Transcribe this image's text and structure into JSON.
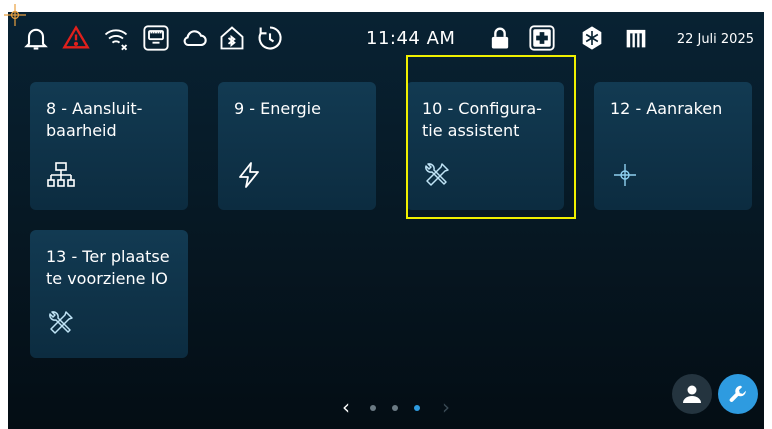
{
  "status_bar": {
    "time": "11:44 AM",
    "date": "22 Juli 2025",
    "icons": [
      "bell-icon",
      "warning-icon",
      "wifi-off-icon",
      "ethernet-icon",
      "cloud-icon",
      "home-bluetooth-icon",
      "timer-icon",
      "lock-icon",
      "medical-cross-icon",
      "snowflake-icon",
      "door-icon"
    ],
    "alert_color": "#e0201c"
  },
  "tiles": [
    {
      "label": "8 - Aansluit-baarheid",
      "icon": "network-icon"
    },
    {
      "label": "9 - Energie",
      "icon": "lightning-icon"
    },
    {
      "label": "10 - Configura-tie assistent",
      "icon": "tools-icon"
    },
    {
      "label": "12 - Aanraken",
      "icon": "crosshair-icon"
    },
    {
      "label": "13 - Ter plaatse te voorziene IO",
      "icon": "tools-icon"
    }
  ],
  "pager": {
    "prev": "‹",
    "next": "›",
    "pages": 3,
    "active_page": 3
  },
  "colors": {
    "tile_bg": "#0f3349",
    "accent": "#2e9be0",
    "highlight": "#f0f000"
  }
}
